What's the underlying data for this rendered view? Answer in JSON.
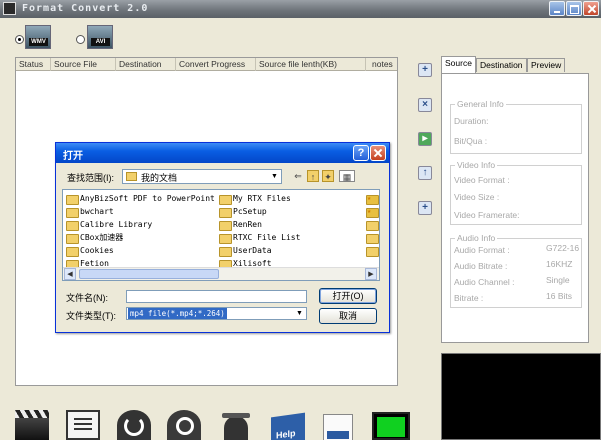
{
  "app": {
    "title": "Format Convert 2.0"
  },
  "formats": [
    {
      "label": "WMV",
      "selected": true
    },
    {
      "label": "AVI",
      "selected": false
    }
  ],
  "table": {
    "columns": [
      "Status",
      "Source File",
      "Destination",
      "Convert Progress",
      "Source file lenth(KB)",
      "notes"
    ]
  },
  "tabs": [
    {
      "label": "Source",
      "active": true
    },
    {
      "label": "Destination",
      "active": false
    },
    {
      "label": "Preview",
      "active": false
    }
  ],
  "info": {
    "general": {
      "title": "General Info",
      "duration_label": "Duration:",
      "bitqua_label": "Bit/Qua :"
    },
    "video": {
      "title": "Video Info",
      "format_label": "Video Format  :",
      "size_label": "Video Size     :",
      "framerate_label": "Video Framerate:"
    },
    "audio": {
      "title": "Audio Info",
      "format_label": "Audio Format  :",
      "format_value": "G722-16",
      "bitrate_label": "Audio Bitrate  :",
      "bitrate_value": "16KHZ",
      "channel_label": "Audio Channel  :",
      "channel_value": "Single",
      "bits_label": "Bitrate     :",
      "bits_value": "16 Bits"
    }
  },
  "toolbar": {
    "help_label": "Help"
  },
  "dialog": {
    "title": "打开",
    "lookin_label": "查找范围(I):",
    "lookin_value": "我的文档",
    "files_col1": [
      "AnyBizSoft PDF to PowerPoint",
      "bwchart",
      "Calibre Library",
      "CBox加速器",
      "Cookies",
      "Fetion"
    ],
    "files_col2": [
      "My RTX Files",
      "PcSetup",
      "RenRen",
      "RTXC File List",
      "UserData",
      "Xilisoft"
    ],
    "filename_label": "文件名(N):",
    "filename_value": "",
    "filetype_label": "文件类型(T):",
    "filetype_value": "mp4 file(*.mp4;*.264)",
    "open_label": "打开(O)",
    "cancel_label": "取消"
  },
  "colors": {
    "dialog_title": "#0a5ee3",
    "selection": "#316ac5",
    "preview_bg": "#000000"
  }
}
